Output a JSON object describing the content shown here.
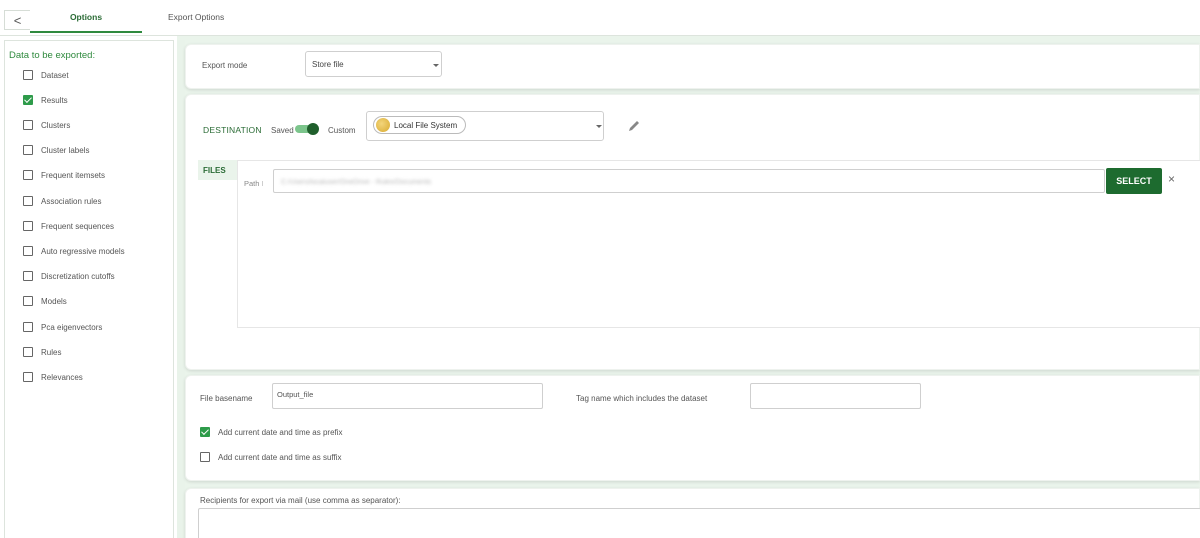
{
  "tabs": {
    "back": "<",
    "options": "Options",
    "export_options": "Export Options"
  },
  "left": {
    "title": "Data to be exported:",
    "items": [
      {
        "label": "Dataset",
        "checked": false
      },
      {
        "label": "Results",
        "checked": true
      },
      {
        "label": "Clusters",
        "checked": false
      },
      {
        "label": "Cluster labels",
        "checked": false
      },
      {
        "label": "Frequent itemsets",
        "checked": false
      },
      {
        "label": "Association rules",
        "checked": false
      },
      {
        "label": "Frequent sequences",
        "checked": false
      },
      {
        "label": "Auto regressive models",
        "checked": false
      },
      {
        "label": "Discretization cutoffs",
        "checked": false
      },
      {
        "label": "Models",
        "checked": false
      },
      {
        "label": "Pca eigenvectors",
        "checked": false
      },
      {
        "label": "Rules",
        "checked": false
      },
      {
        "label": "Relevances",
        "checked": false
      }
    ]
  },
  "export_mode": {
    "label": "Export mode",
    "value": "Store file"
  },
  "destination": {
    "title": "DESTINATION",
    "saved_label": "Saved",
    "custom_label": "Custom",
    "location": "Local File System",
    "files_tag": "FILES",
    "path_label": "Path",
    "path_value": "C:/Users/localuser/OneDrive - Rulex/Documents",
    "select_label": "SELECT",
    "clear_glyph": "×"
  },
  "file_options": {
    "basename_label": "File basename",
    "basename_value": "Output_file",
    "tag_label": "Tag name which includes the dataset",
    "tag_value": "",
    "prefix_label": "Add current date and time as prefix",
    "prefix_checked": true,
    "suffix_label": "Add current date and time as suffix",
    "suffix_checked": false
  },
  "mail": {
    "label": "Recipients for export via mail (use comma as separator):",
    "value": ""
  },
  "colors": {
    "accent": "#2f8a3e",
    "select_button": "#1d6b2f",
    "panel_bg": "#eaf4eb"
  }
}
